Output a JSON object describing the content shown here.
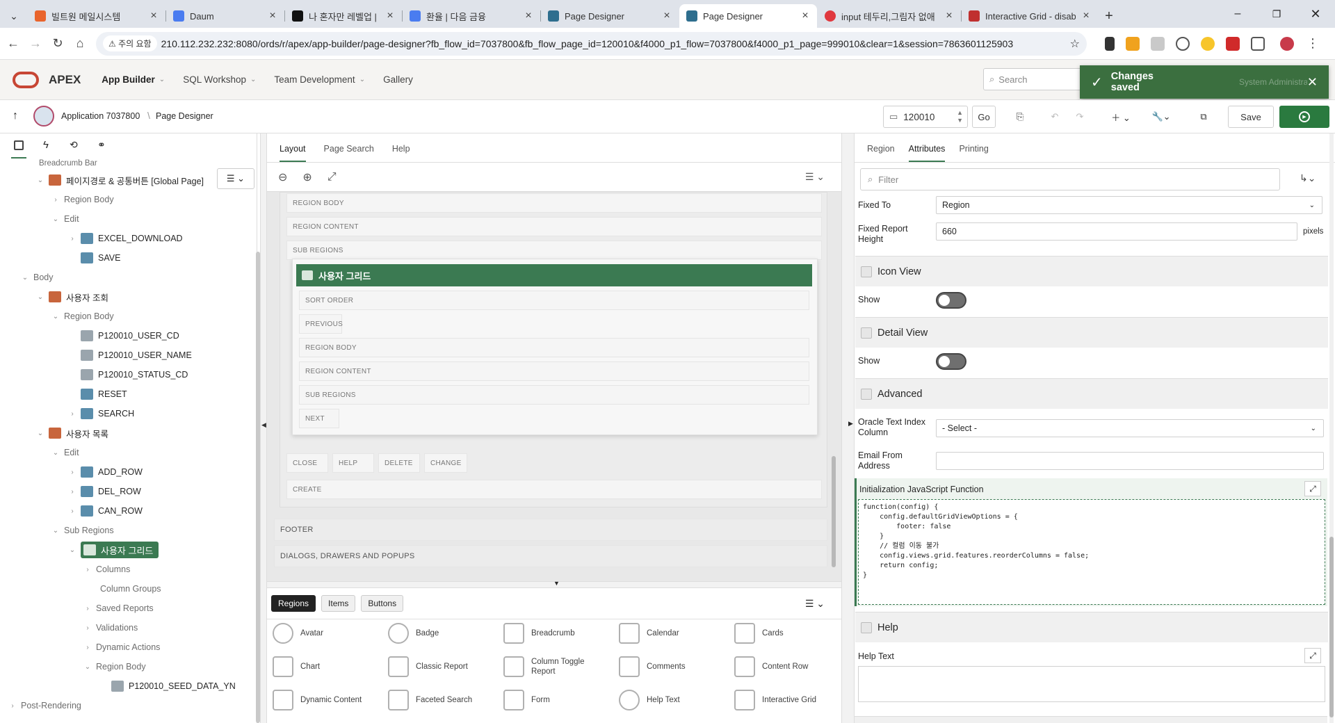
{
  "browser": {
    "tabs": [
      {
        "title": "빌트원 메일시스템",
        "fav_color": "#e9642c",
        "active": false
      },
      {
        "title": "Daum",
        "fav_color": "#4a7cf0",
        "active": false
      },
      {
        "title": "나 혼자만 레벨업 | 카카오",
        "fav_color": "#111111",
        "active": false
      },
      {
        "title": "환율 | 다음 금융",
        "fav_color": "#4a7cf0",
        "active": false
      },
      {
        "title": "Page Designer",
        "fav_color": "#2e6e8e",
        "active": false
      },
      {
        "title": "Page Designer",
        "fav_color": "#2e6e8e",
        "active": true
      },
      {
        "title": "input 테두리,그림자 없애",
        "fav_color": "#e0383e",
        "active": false
      },
      {
        "title": "Interactive Grid - disable",
        "fav_color": "#c0302f",
        "active": false
      }
    ],
    "new_tab": "+",
    "security_chip": "주의 요함",
    "url": "210.112.232.232:8080/ords/r/apex/app-builder/page-designer?fb_flow_id=7037800&fb_flow_page_id=120010&f4000_p1_flow=7037800&f4000_p1_page=999010&clear=1&session=7863601125903"
  },
  "apex": {
    "logo_text": "APEX",
    "menu": [
      "App Builder",
      "SQL Workshop",
      "Team Development",
      "Gallery"
    ],
    "search_placeholder": "Search",
    "toast": "Changes saved",
    "user": "System Administrator"
  },
  "toolbar": {
    "app_label": "Application 7037800",
    "crumb": "Page Designer",
    "page_number": "120010",
    "go": "Go",
    "save": "Save"
  },
  "tree": {
    "breadcrumb_bar": "Breadcrumb Bar",
    "global_region": "페이지경로 & 공통버튼 [Global Page]",
    "region_body_1": "Region Body",
    "edit_1": "Edit",
    "excel": "EXCEL_DOWNLOAD",
    "save": "SAVE",
    "body": "Body",
    "search_region": "사용자 조회",
    "region_body_2": "Region Body",
    "user_cd": "P120010_USER_CD",
    "user_name": "P120010_USER_NAME",
    "status_cd": "P120010_STATUS_CD",
    "reset": "RESET",
    "search": "SEARCH",
    "list_region": "사용자 목록",
    "edit_2": "Edit",
    "add_row": "ADD_ROW",
    "del_row": "DEL_ROW",
    "can_row": "CAN_ROW",
    "sub_regions": "Sub Regions",
    "grid": "사용자 그리드",
    "columns": "Columns",
    "column_groups": "Column Groups",
    "saved_reports": "Saved Reports",
    "validations": "Validations",
    "dynamic_actions": "Dynamic Actions",
    "region_body_3": "Region Body",
    "seed": "P120010_SEED_DATA_YN",
    "post_rendering": "Post-Rendering"
  },
  "center": {
    "tabs": [
      "Layout",
      "Page Search",
      "Help"
    ],
    "slots": {
      "region_body": "REGION BODY",
      "region_content": "REGION CONTENT",
      "sub_regions": "SUB REGIONS",
      "grid_title": "사용자 그리드",
      "sort_order": "SORT ORDER",
      "previous": "PREVIOUS",
      "inner_region_body": "REGION BODY",
      "inner_region_content": "REGION CONTENT",
      "inner_sub_regions": "SUB REGIONS",
      "next": "NEXT",
      "close": "CLOSE",
      "help": "HELP",
      "delete": "DELETE",
      "change": "CHANGE",
      "create": "CREATE",
      "footer": "FOOTER",
      "dialogs": "DIALOGS, DRAWERS AND POPUPS"
    },
    "gallery_tabs": [
      "Regions",
      "Items",
      "Buttons"
    ],
    "gallery": [
      [
        "Avatar",
        "Badge",
        "Breadcrumb",
        "Calendar",
        "Cards"
      ],
      [
        "Chart",
        "Classic Report",
        "Column Toggle Report",
        "Comments",
        "Content Row"
      ],
      [
        "Dynamic Content",
        "Faceted Search",
        "Form",
        "Help Text",
        "Interactive Grid"
      ]
    ]
  },
  "props": {
    "tabs": [
      "Region",
      "Attributes",
      "Printing"
    ],
    "filter_placeholder": "Filter",
    "fixed_to_label": "Fixed To",
    "fixed_to_value": "Region",
    "fixed_height_label": "Fixed Report Height",
    "fixed_height_value": "660",
    "fixed_height_unit": "pixels",
    "icon_view": "Icon View",
    "detail_view": "Detail View",
    "show": "Show",
    "advanced": "Advanced",
    "oracle_text_label": "Oracle Text Index Column",
    "oracle_text_value": "- Select -",
    "email_label": "Email From Address",
    "init_js_label": "Initialization JavaScript Function",
    "init_js_code": "function(config) {\n    config.defaultGridViewOptions = {\n        footer: false\n    }\n    // 컬럼 이동 불가\n    config.views.grid.features.reorderColumns = false;\n    return config;\n}",
    "help": "Help",
    "help_text_label": "Help Text"
  },
  "colors": {
    "accent_green": "#3b7a52",
    "toast": "#3b6f3f",
    "run_button": "#2a7a3f"
  }
}
